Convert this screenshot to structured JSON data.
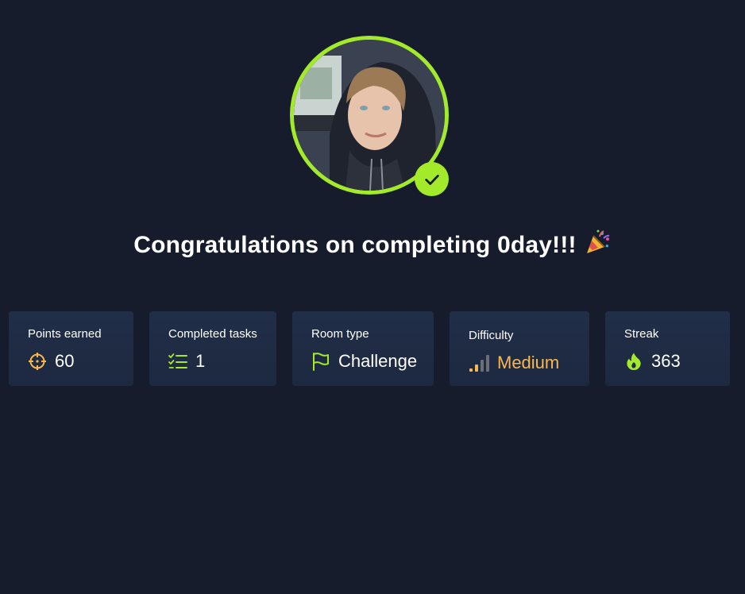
{
  "avatar": {
    "alt": "User avatar",
    "verified": true,
    "ring_color": "#a3ea2a"
  },
  "title": {
    "text": "Congratulations on completing 0day!!!",
    "emoji": "party-popper"
  },
  "stats": {
    "points": {
      "label": "Points earned",
      "value": "60",
      "icon": "crosshair-icon"
    },
    "tasks": {
      "label": "Completed tasks",
      "value": "1",
      "icon": "checklist-icon"
    },
    "room_type": {
      "label": "Room type",
      "value": "Challenge",
      "icon": "flag-icon"
    },
    "difficulty": {
      "label": "Difficulty",
      "value": "Medium",
      "icon": "signal-bars-icon",
      "color": "#f9b84e"
    },
    "streak": {
      "label": "Streak",
      "value": "363",
      "icon": "flame-icon"
    }
  },
  "colors": {
    "background": "#161c2b",
    "card": "#1f2b44",
    "accent_green": "#a3ea2a",
    "accent_orange": "#f9b84e"
  }
}
